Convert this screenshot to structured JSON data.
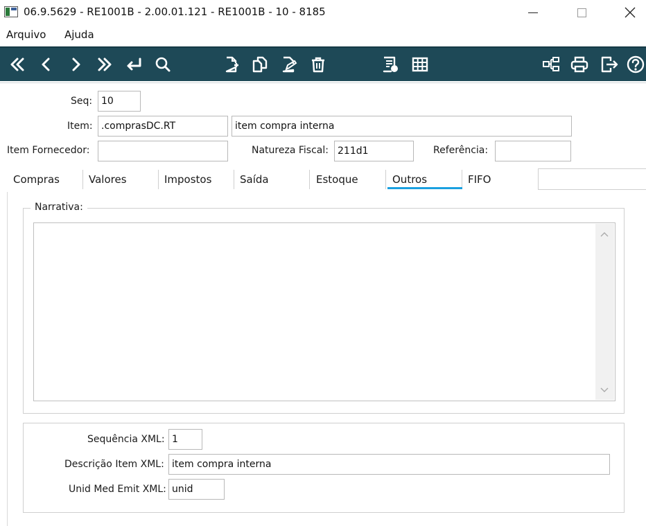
{
  "window": {
    "title": "06.9.5629 - RE1001B - 2.00.01.121 - RE1001B - 10 - 8185"
  },
  "menu": {
    "arquivo": "Arquivo",
    "ajuda": "Ajuda"
  },
  "form": {
    "seq_label": "Seq:",
    "seq_value": "10",
    "item_label": "Item:",
    "item_code": ".comprasDC.RT",
    "item_desc": "item compra interna",
    "fornecedor_label": "Item Fornecedor:",
    "fornecedor_value": "",
    "natureza_label": "Natureza Fiscal:",
    "natureza_value": "211d1",
    "referencia_label": "Referência:",
    "referencia_value": ""
  },
  "tabs": [
    {
      "label": "Compras"
    },
    {
      "label": "Valores"
    },
    {
      "label": "Impostos"
    },
    {
      "label": "Saída"
    },
    {
      "label": "Estoque"
    },
    {
      "label": "Outros",
      "active": true
    },
    {
      "label": "FIFO"
    }
  ],
  "outros": {
    "narrativa_label": "Narrativa:",
    "narrativa_value": "",
    "seq_xml_label": "Sequência XML:",
    "seq_xml_value": "1",
    "desc_xml_label": "Descrição Item XML:",
    "desc_xml_value": "item compra interna",
    "unid_xml_label": "Unid Med Emit XML:",
    "unid_xml_value": "unid"
  },
  "colors": {
    "toolbar_bg": "#1e4957",
    "icon": "#ffffff",
    "tab_accent": "#1aa0e0"
  },
  "toolbar_icons": [
    "first-icon",
    "previous-icon",
    "next-icon",
    "last-icon",
    "goto-icon",
    "search-icon",
    "new-document-icon",
    "copy-icon",
    "edit-icon",
    "delete-icon",
    "list-icon",
    "grid-icon",
    "hierarchy-icon",
    "print-icon",
    "exit-icon",
    "help-icon"
  ]
}
